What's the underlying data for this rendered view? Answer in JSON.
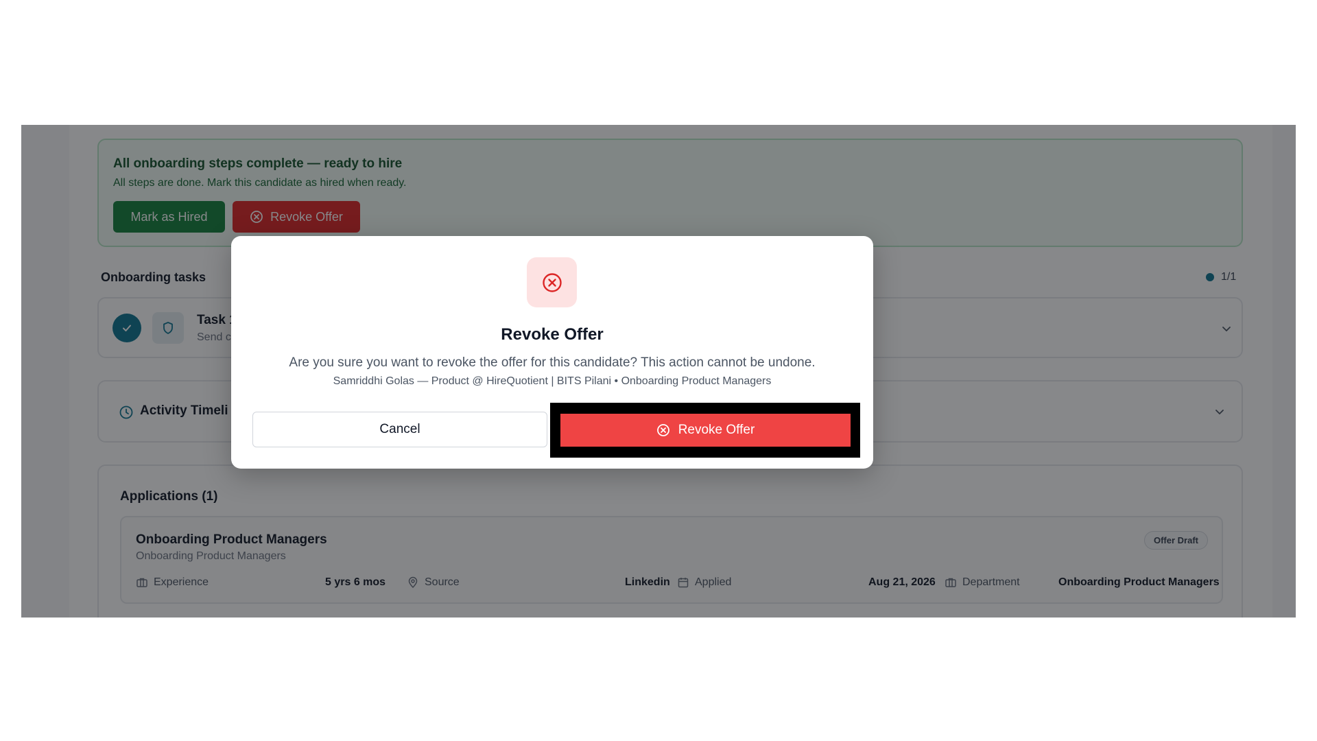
{
  "banner": {
    "title": "All onboarding steps complete — ready to hire",
    "subtitle": "All steps are done. Mark this candidate as hired when ready.",
    "mark_hired_label": "Mark as Hired",
    "revoke_label": "Revoke Offer"
  },
  "tasks": {
    "title": "Onboarding tasks",
    "counter": "1/1",
    "task_title": "Task 1",
    "task_sub": "Send c"
  },
  "activity": {
    "title": "Activity Timeli"
  },
  "applications": {
    "title": "Applications (1)",
    "item": {
      "title": "Onboarding Product Managers",
      "subtitle": "Onboarding Product Managers",
      "badge": "Offer Draft",
      "experience_label": "Experience",
      "experience_value": "5 yrs 6 mos",
      "source_label": "Source",
      "source_value": "Linkedin",
      "applied_label": "Applied",
      "applied_value": "Aug 21, 2026",
      "department_label": "Department",
      "department_value": "Onboarding Product Managers"
    }
  },
  "modal": {
    "title": "Revoke Offer",
    "body": "Are you sure you want to revoke the offer for this candidate? This action cannot be undone.",
    "meta": "Samriddhi Golas — Product @ HireQuotient | BITS Pilani • Onboarding Product Managers",
    "cancel_label": "Cancel",
    "confirm_label": "Revoke Offer"
  },
  "colors": {
    "accent_teal": "#0e7490",
    "danger": "#ef4444",
    "success": "#15803d"
  }
}
